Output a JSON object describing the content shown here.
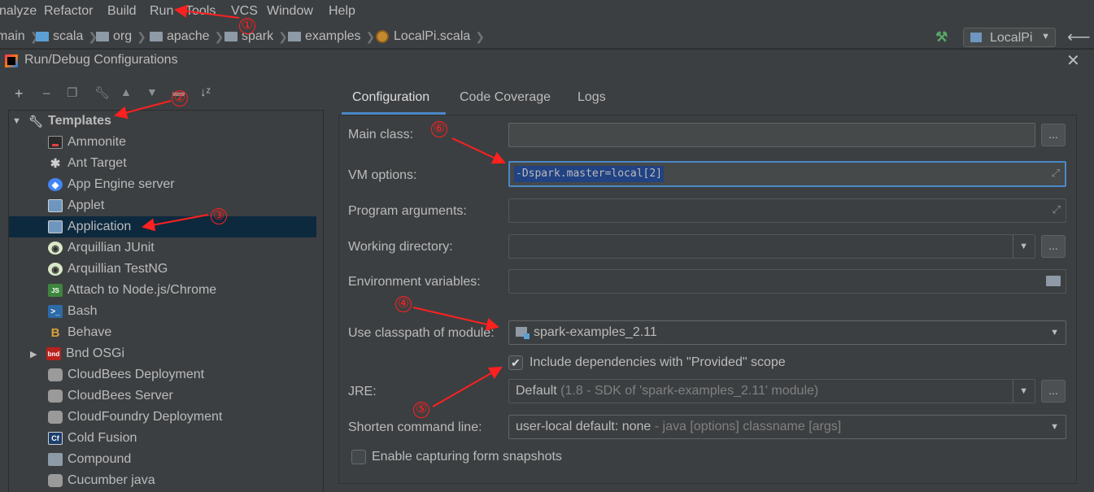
{
  "menu": [
    "nalyze",
    "Refactor",
    "Build",
    "Run",
    "Tools",
    "VCS",
    "Window",
    "Help"
  ],
  "breadcrumb": [
    "main",
    "scala",
    "org",
    "apache",
    "spark",
    "examples",
    "LocalPi.scala"
  ],
  "run_config": "LocalPi",
  "dialog": {
    "title": "Run/Debug Configurations",
    "templates_label": "Templates",
    "tree_items": [
      {
        "label": "Ammonite",
        "icon": "ammonite-icon"
      },
      {
        "label": "Ant Target",
        "icon": "ant-icon"
      },
      {
        "label": "App Engine server",
        "icon": "app-engine-icon"
      },
      {
        "label": "Applet",
        "icon": "applet-icon"
      },
      {
        "label": "Application",
        "icon": "application-icon"
      },
      {
        "label": "Arquillian JUnit",
        "icon": "arquillian-icon"
      },
      {
        "label": "Arquillian TestNG",
        "icon": "arquillian-icon"
      },
      {
        "label": "Attach to Node.js/Chrome",
        "icon": "nodejs-icon"
      },
      {
        "label": "Bash",
        "icon": "bash-icon"
      },
      {
        "label": "Behave",
        "icon": "behave-icon"
      },
      {
        "label": "Bnd OSGi",
        "icon": "bnd-icon"
      },
      {
        "label": "CloudBees Deployment",
        "icon": "cloud-icon"
      },
      {
        "label": "CloudBees Server",
        "icon": "cloud-icon"
      },
      {
        "label": "CloudFoundry Deployment",
        "icon": "cloud-icon"
      },
      {
        "label": "Cold Fusion",
        "icon": "coldfusion-icon"
      },
      {
        "label": "Compound",
        "icon": "compound-icon"
      },
      {
        "label": "Cucumber java",
        "icon": "cucumber-icon"
      }
    ],
    "tabs": [
      "Configuration",
      "Code Coverage",
      "Logs"
    ],
    "form": {
      "main_class_label": "Main class:",
      "vm_options_label": "VM options:",
      "vm_options_value": "-Dspark.master=local[2]",
      "program_args_label": "Program arguments:",
      "working_dir_label": "Working directory:",
      "env_vars_label": "Environment variables:",
      "classpath_label": "Use classpath of module:",
      "classpath_value": "spark-examples_2.11",
      "include_deps_label": "Include dependencies with \"Provided\" scope",
      "include_deps_checked": true,
      "jre_label": "JRE:",
      "jre_value": "Default",
      "jre_detail": "(1.8 - SDK of 'spark-examples_2.11' module)",
      "shorten_label": "Shorten command line:",
      "shorten_value": "user-local default: none",
      "shorten_detail": "- java [options] classname [args]",
      "snapshots_label": "Enable capturing form snapshots",
      "snapshots_checked": false,
      "browse": "..."
    }
  },
  "annotations": [
    "①",
    "②",
    "③",
    "④",
    "⑤",
    "⑥"
  ],
  "colors": {
    "annotation": "#ff2020",
    "selection": "#0d293e",
    "accent": "#4a88c7"
  }
}
